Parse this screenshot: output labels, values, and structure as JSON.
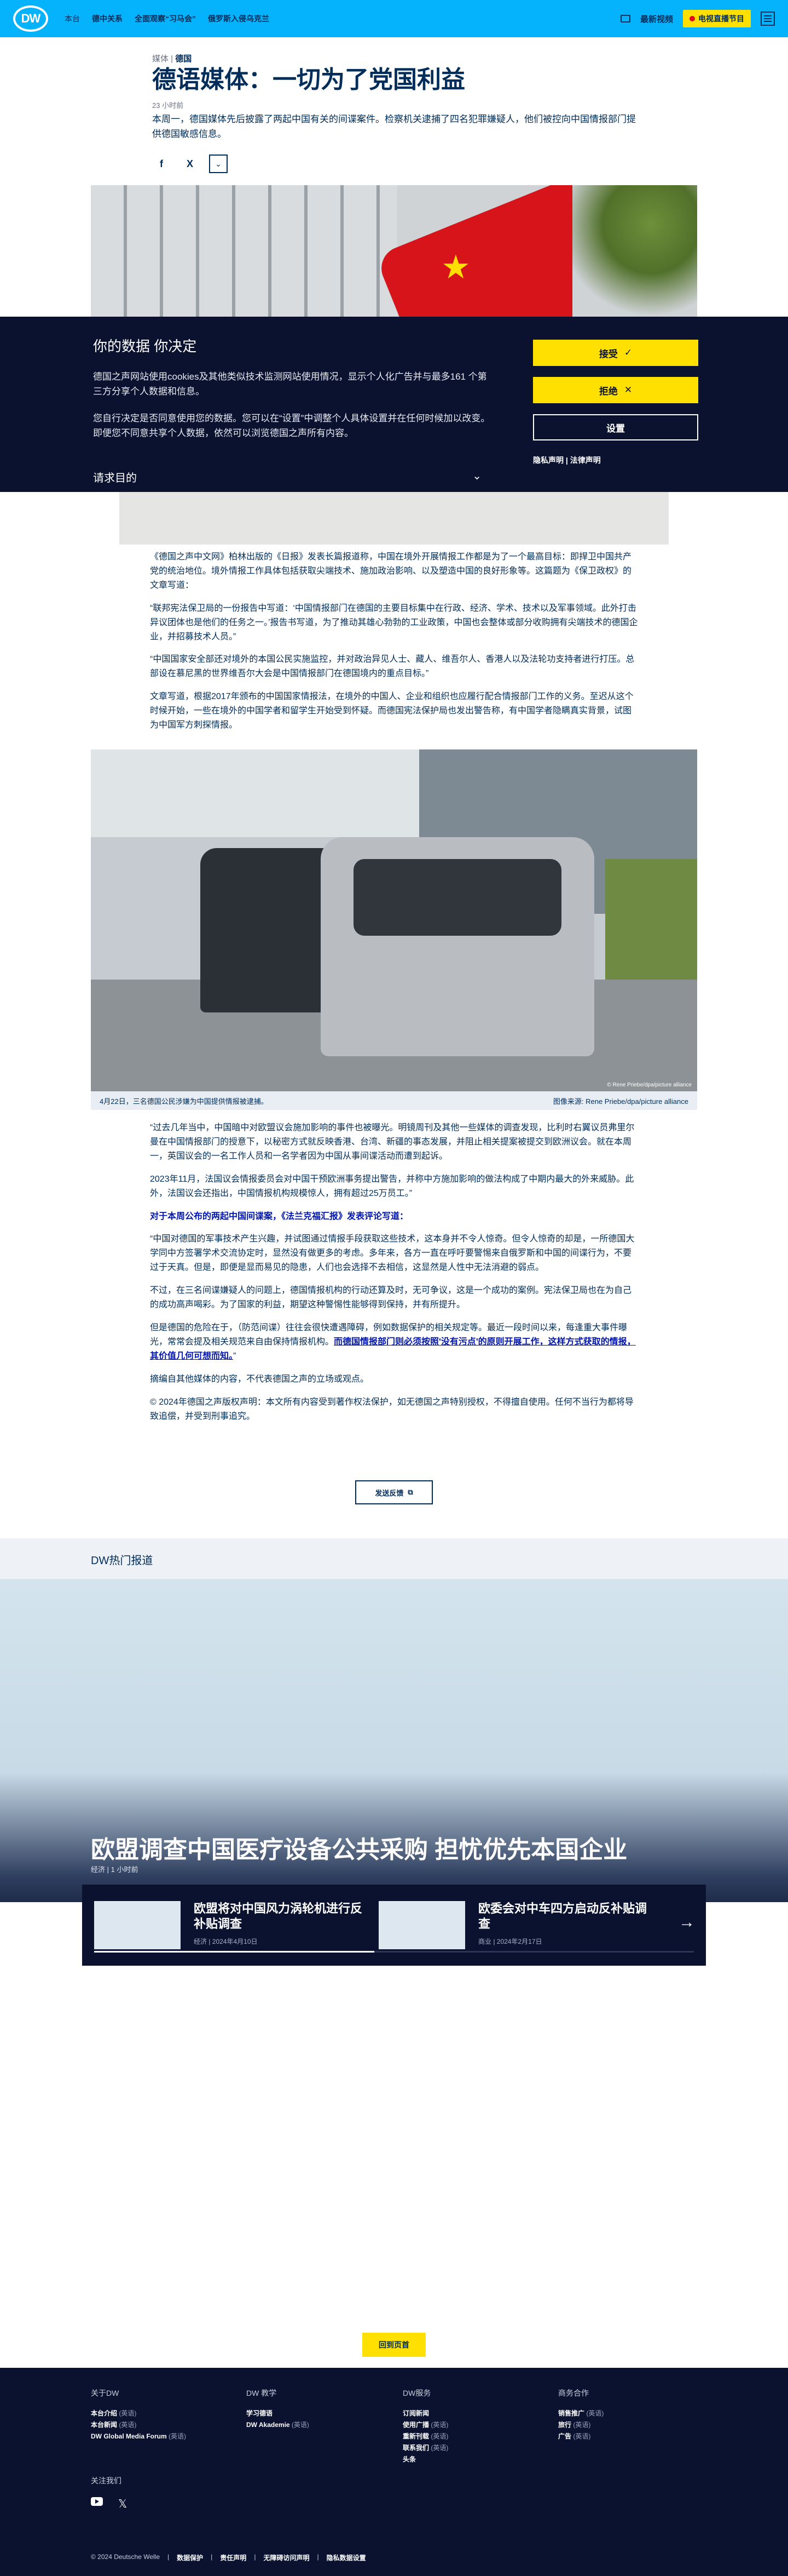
{
  "header": {
    "logo": "DW",
    "nav_first": "本台",
    "nav": [
      "德中关系",
      "全面观察“习马会”",
      "俄罗斯入侵乌克兰"
    ],
    "latest_video": "最新视频",
    "live_tv": "电视直播节目"
  },
  "article": {
    "breadcrumb_prefix": "媒体",
    "breadcrumb_section": "德国",
    "headline": "德语媒体：一切为了党国利益",
    "time": "23 小时前",
    "teaser": "本周一，德国媒体先后披露了两起中国有关的间谍案件。检察机关逮捕了四名犯罪嫌疑人，他们被控向中国情报部门提供德国敏感信息。"
  },
  "share": {
    "facebook": "f",
    "x": "X",
    "more": "⌄"
  },
  "cookie": {
    "title": "你的数据 你决定",
    "p1": "德国之声网站使用cookies及其他类似技术监测网站使用情况，显示个人化广告并与最多161 个第三方分享个人数据和信息。",
    "p2": "您自行决定是否同意使用您的数据。您可以在“设置”中调整个人具体设置并在任何时候加以改变。即便您不同意共享个人数据，依然可以浏览德国之声所有内容。",
    "purpose": "请求目的",
    "accept": "接受",
    "reject": "拒绝",
    "settings": "设置",
    "privacy": "隐私声明",
    "legal": "法律声明"
  },
  "body": {
    "p1": "《德国之声中文网》柏林出版的《日报》发表长篇报道称，中国在境外开展情报工作都是为了一个最高目标：即捍卫中国共产党的统治地位。境外情报工作具体包括获取尖端技术、施加政治影响、以及塑造中国的良好形象等。这篇题为《保卫政权》的文章写道：",
    "p2": "“联邦宪法保卫局的一份报告中写道：‘中国情报部门在德国的主要目标集中在行政、经济、学术、技术以及军事领域。此外打击异议团体也是他们的任务之一。’报告书写道，为了推动其雄心勃勃的工业政策，中国也会整体或部分收购拥有尖端技术的德国企业，并招募技术人员。”",
    "p3": "“中国国家安全部还对境外的本国公民实施监控，并对政治异见人士、藏人、维吾尔人、香港人以及法轮功支持者进行打压。总部设在慕尼黑的世界维吾尔大会是中国情报部门在德国境内的重点目标。”",
    "p4": "文章写道，根据2017年颁布的中国国家情报法，在境外的中国人、企业和组织也应履行配合情报部门工作的义务。至迟从这个时候开始，一些在境外的中国学者和留学生开始受到怀疑。而德国宪法保护局也发出警告称，有中国学者隐瞒真实背景，试图为中国军方刺探情报。",
    "p5": "“过去几年当中，中国暗中对欧盟议会施加影响的事件也被曝光。明镜周刊及其他一些媒体的调查发现，比利时右翼议员弗里尔曼在中国情报部门的授意下，以秘密方式就反映香港、台湾、新疆的事态发展，并阻止相关提案被提交到欧洲议会。就在本周一，英国议会的一名工作人员和一名学者因为中国从事间谍活动而遭到起诉。",
    "p6": "2023年11月，法国议会情报委员会对中国干预欧洲事务提出警告，并称中方施加影响的做法构成了中期内最大的外来威胁。此外，法国议会还指出，中国情报机构规模惊人，拥有超过25万员工。”",
    "p7_bold": "对于本周公布的两起中国间谍案，《法兰克福汇报》发表评论写道：",
    "p8": "“中国对德国的军事技术产生兴趣，并试图通过情报手段获取这些技术，这本身并不令人惊奇。但令人惊奇的却是，一所德国大学同中方签署学术交流协定时，显然没有做更多的考虑。多年来，各方一直在呼吁要警惕来自俄罗斯和中国的间谍行为，不要过于天真。但是，即便是显而易见的隐患，人们也会选择不去相信，这显然是人性中无法消避的弱点。",
    "p9": "不过，在三名间谍嫌疑人的问题上，德国情报机构的行动还算及时，无可争议，这是一个成功的案例。宪法保卫局也在为自己的成功高声喝彩。为了国家的利益，期望这种警惕性能够得到保持，并有所提升。",
    "p10_a": "但是德国的危险在于，（防范间谍）往往会很快遭遇障碍，例如数据保护的相关规定等。最近一段时间以来，每逢重大事件曝光，常常会提及相关规范来自由保持情报机构。",
    "p10_b": "而德国情报部门则必须按照'没有污点'的原则开展工作，这样方式获取的情报，其价值几何可想而知。",
    "p10_c": "”",
    "p11": "摘编自其他媒体的内容，不代表德国之声的立场或观点。",
    "p12": "© 2024年德国之声版权声明：本文所有内容受到著作权法保护，如无德国之声特别授权，不得擅自使用。任何不当行为都将导致追偿，并受到刑事追究。"
  },
  "photo": {
    "caption": "4月22日，三名德国公民涉嫌为中国提供情报被逮捕。",
    "credit": "图像来源: Rene Priebe/dpa/picture alliance",
    "overlay_credit": "© Rene Priebe/dpa/picture alliance"
  },
  "feedback": "发送反馈",
  "hot": {
    "section_title": "DW热门报道",
    "headline": "欧盟调查中国医疗设备公共采购 担忧优先本国企业",
    "meta": "经济 | 1 小时前",
    "cards": [
      {
        "title": "欧盟将对中国风力涡轮机进行反补贴调查",
        "meta": "经济 | 2024年4月10日"
      },
      {
        "title": "欧委会对中车四方启动反补贴调查",
        "meta": "商业 | 2024年2月17日"
      }
    ]
  },
  "back_to_top": "回到页首",
  "footer": {
    "cols": [
      {
        "title": "关于DW",
        "items": [
          [
            "本台介绍",
            "(英语)"
          ],
          [
            "本台新闻",
            "(英语)"
          ],
          [
            "DW Global Media Forum",
            "(英语)"
          ]
        ]
      },
      {
        "title": "DW 教学",
        "items": [
          [
            "学习德语",
            ""
          ],
          [
            "DW Akademie",
            "(英语)"
          ]
        ]
      },
      {
        "title": "DW服务",
        "items": [
          [
            "订阅新闻",
            ""
          ],
          [
            "使用广播",
            "(英语)"
          ],
          [
            "重新刊载",
            "(英语)"
          ],
          [
            "联系我们",
            "(英语)"
          ],
          [
            "头条",
            ""
          ]
        ]
      },
      {
        "title": "商务合作",
        "items": [
          [
            "销售推广",
            "(英语)"
          ],
          [
            "旅行",
            "(英语)"
          ],
          [
            "广告",
            "(英语)"
          ]
        ]
      }
    ],
    "follow": "关注我们",
    "legal": [
      "© 2024 Deutsche Welle",
      "数据保护",
      "责任声明",
      "无障碍访问声明",
      "隐私数据设置"
    ]
  }
}
